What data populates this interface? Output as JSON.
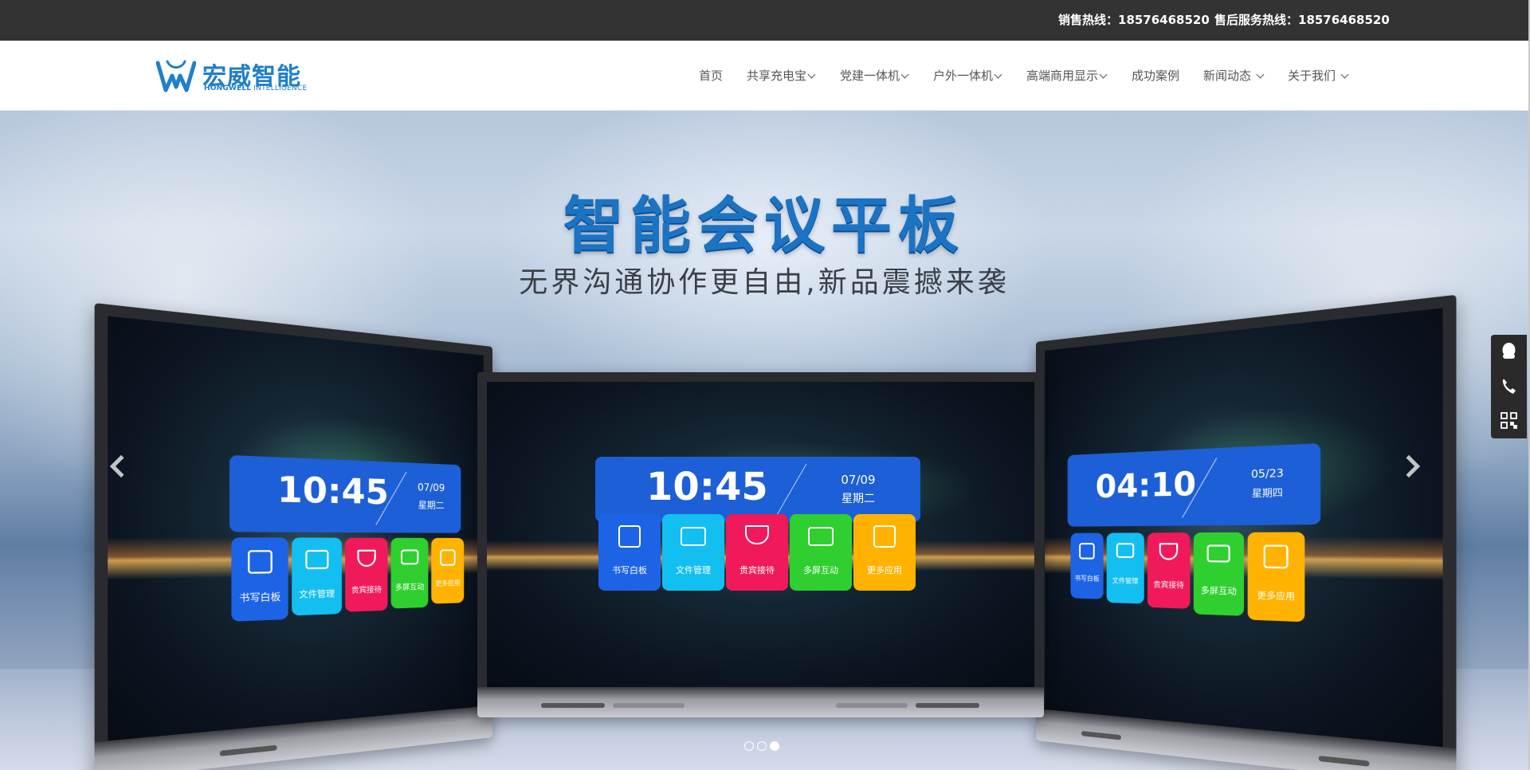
{
  "topbar": {
    "sales_hotline": "销售热线：18576468520",
    "service_hotline": "售后服务热线：18576468520"
  },
  "logo": {
    "cn": "宏威智能",
    "en_bold": "HONGWELL",
    "en_rest": " INTELLIGENCE"
  },
  "nav": {
    "items": [
      {
        "label": "首页",
        "dropdown": false
      },
      {
        "label": "共享充电宝",
        "dropdown": true
      },
      {
        "label": "党建一体机",
        "dropdown": true
      },
      {
        "label": "户外一体机",
        "dropdown": true
      },
      {
        "label": "高端商用显示",
        "dropdown": true
      },
      {
        "label": "成功案例",
        "dropdown": false
      },
      {
        "label": "新闻动态",
        "dropdown": true
      },
      {
        "label": "关于我们",
        "dropdown": true
      }
    ]
  },
  "banner": {
    "title": "智能会议平板",
    "subtitle": "无界沟通协作更自由,新品震撼来袭",
    "slide_count": 3,
    "active_slide": 3,
    "screens": {
      "left": {
        "time": "10:45",
        "date": "07/09",
        "weekday": "星期二"
      },
      "center": {
        "time": "10:45",
        "date": "07/09",
        "weekday": "星期二"
      },
      "right": {
        "time": "04:10",
        "date": "05/23",
        "weekday": "星期四"
      }
    },
    "tiles": [
      {
        "label": "书写白板",
        "color": "#1d63e6"
      },
      {
        "label": "文件管理",
        "color": "#12bff0"
      },
      {
        "label": "贵宾接待",
        "color": "#f0195a"
      },
      {
        "label": "多屏互动",
        "color": "#2fcf2f"
      },
      {
        "label": "更多应用",
        "color": "#ffb300"
      }
    ]
  },
  "floatbar": {
    "icons": [
      "qq-icon",
      "phone-icon",
      "qrcode-icon"
    ]
  },
  "colors": {
    "brand": "#1f7fcc",
    "topbar": "#333333"
  }
}
